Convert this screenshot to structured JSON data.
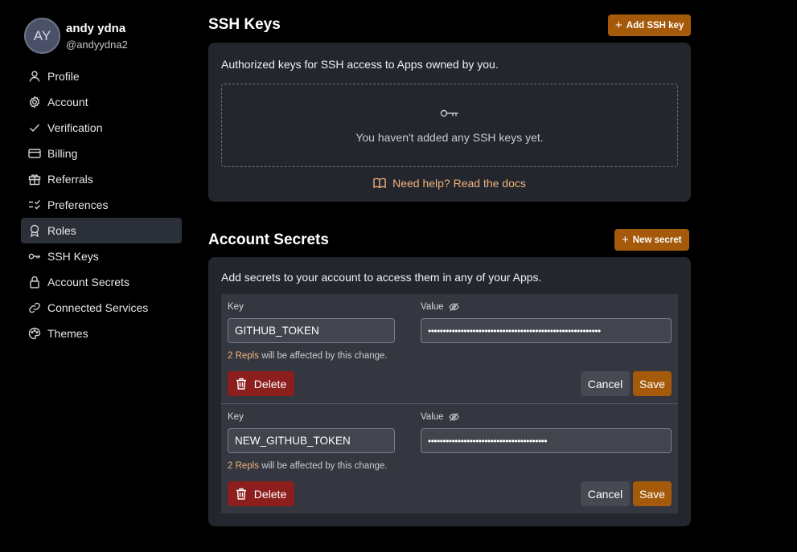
{
  "profile": {
    "initials": "AY",
    "name": "andy ydna",
    "handle": "@andyydna2"
  },
  "nav": [
    {
      "label": "Profile",
      "icon": "user-icon"
    },
    {
      "label": "Account",
      "icon": "gear-icon"
    },
    {
      "label": "Verification",
      "icon": "check-icon"
    },
    {
      "label": "Billing",
      "icon": "credit-card-icon"
    },
    {
      "label": "Referrals",
      "icon": "gift-icon"
    },
    {
      "label": "Preferences",
      "icon": "checklist-icon"
    },
    {
      "label": "Roles",
      "icon": "badge-icon",
      "active": true
    },
    {
      "label": "SSH Keys",
      "icon": "key-icon"
    },
    {
      "label": "Account Secrets",
      "icon": "lock-icon"
    },
    {
      "label": "Connected Services",
      "icon": "link-icon"
    },
    {
      "label": "Themes",
      "icon": "palette-icon"
    }
  ],
  "ssh": {
    "title": "SSH Keys",
    "add_label": "Add SSH key",
    "description": "Authorized keys for SSH access to Apps owned by you.",
    "empty_text": "You haven't added any SSH keys yet.",
    "help_text": "Need help? Read the docs"
  },
  "secrets": {
    "title": "Account Secrets",
    "new_label": "New secret",
    "description": "Add secrets to your account to access them in any of your Apps.",
    "key_label": "Key",
    "value_label": "Value",
    "affect_link": "2 Repls",
    "affect_text": " will be affected by this change.",
    "delete_label": "Delete",
    "cancel_label": "Cancel",
    "save_label": "Save",
    "items": [
      {
        "key": "GITHUB_TOKEN",
        "value": "••••••••••••••••••••••••••••••••••••••••••••••••••••••••••"
      },
      {
        "key": "NEW_GITHUB_TOKEN",
        "value": "••••••••••••••••••••••••••••••••••••••••"
      }
    ]
  },
  "colors": {
    "accent": "#a45a0a",
    "danger": "#8c1e1e",
    "link": "#f1b27c",
    "card": "#23262d"
  }
}
